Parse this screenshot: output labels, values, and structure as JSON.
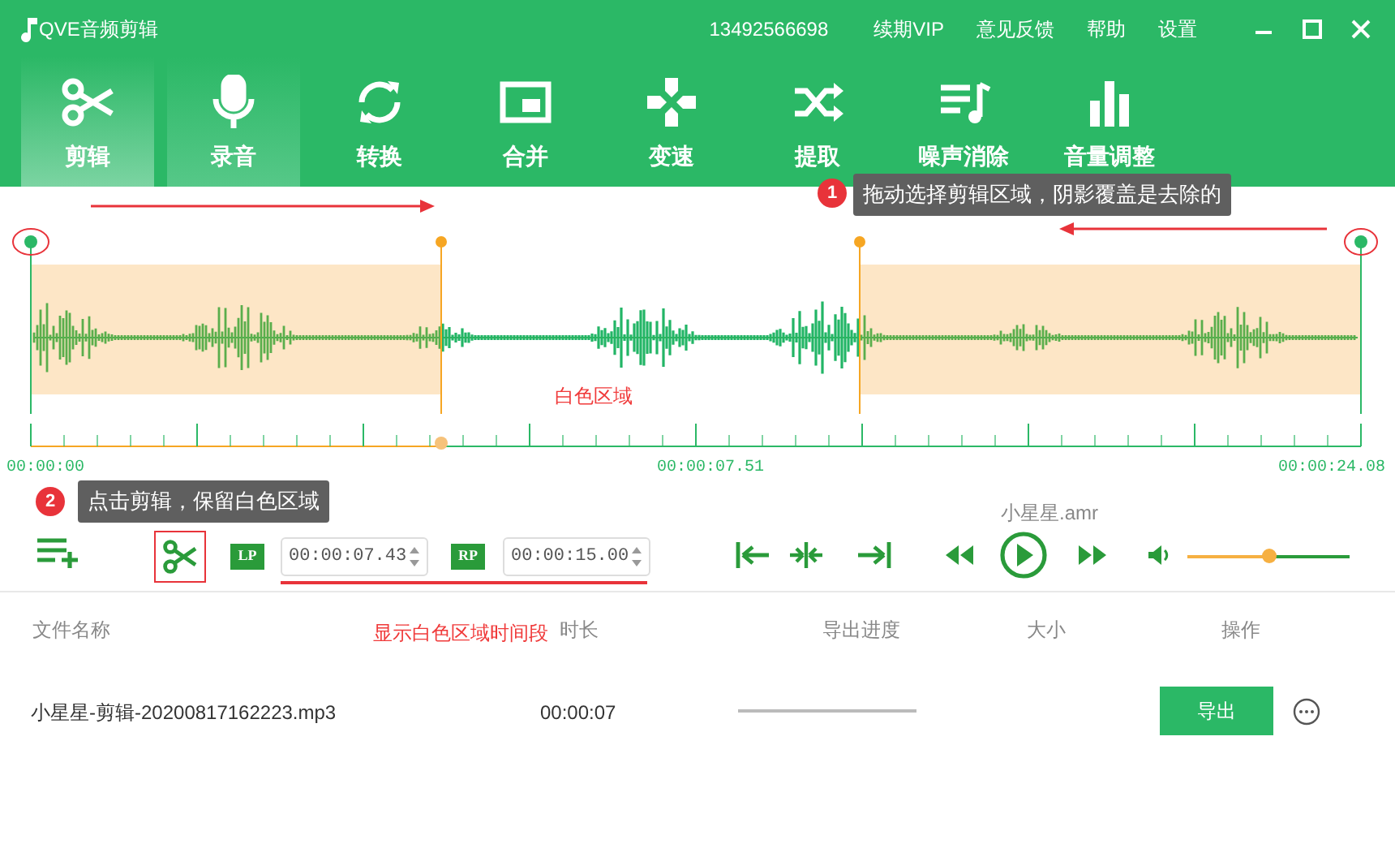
{
  "window": {
    "title": "QVE音频剪辑"
  },
  "header_links": [
    "13492566698",
    "续期VIP",
    "意见反馈",
    "帮助",
    "设置"
  ],
  "tabs": [
    {
      "label": "剪辑",
      "kind": "scissors",
      "selected": true,
      "hovered": false
    },
    {
      "label": "录音",
      "kind": "mic",
      "selected": false,
      "hovered": true
    },
    {
      "label": "转换",
      "kind": "refresh",
      "selected": false,
      "hovered": false
    },
    {
      "label": "合并",
      "kind": "pip",
      "selected": false,
      "hovered": false
    },
    {
      "label": "变速",
      "kind": "cross",
      "selected": false,
      "hovered": false
    },
    {
      "label": "提取",
      "kind": "shuffle",
      "selected": false,
      "hovered": false
    },
    {
      "label": "噪声消除",
      "kind": "playlist",
      "selected": false,
      "hovered": false
    },
    {
      "label": "音量调整",
      "kind": "bars",
      "selected": false,
      "hovered": false
    }
  ],
  "tooltips": [
    {
      "number": "1",
      "text": "拖动选择剪辑区域，阴影覆盖是去除的"
    },
    {
      "number": "2",
      "text": "点击剪辑，保留白色区域"
    }
  ],
  "annotations": [
    "白色区域",
    "显示白色区域时间段"
  ],
  "timeline": {
    "start": "00:00:00",
    "marker": "00:00:07.51",
    "end": "00:00:24.08"
  },
  "controls": {
    "lp_label": "LP",
    "lp_time": "00:00:07.43",
    "rp_label": "RP",
    "rp_time": "00:00:15.00",
    "file_name": "小星星.amr",
    "volume": {
      "level": 0.5
    }
  },
  "table": {
    "columns": [
      "文件名称",
      "时长",
      "导出进度",
      "大小",
      "操作"
    ],
    "rows": [
      {
        "file_name": "小星星-剪辑-20200817162223.mp3",
        "duration": "00:00:07",
        "progress": {
          "level": 0
        },
        "action": "导出"
      }
    ]
  }
}
